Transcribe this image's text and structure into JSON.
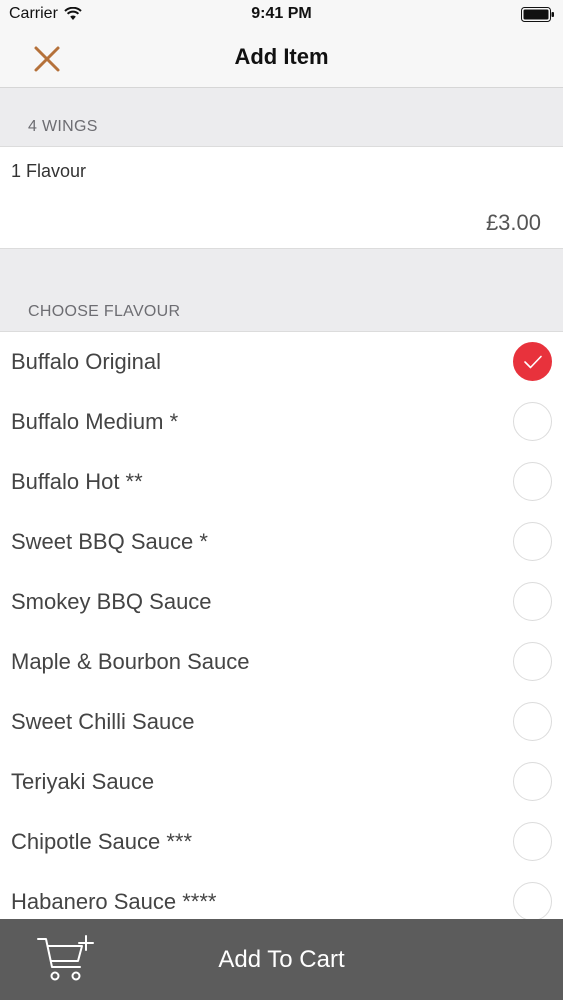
{
  "status_bar": {
    "carrier": "Carrier",
    "time": "9:41 PM",
    "icons": [
      "wifi-icon",
      "battery-icon"
    ]
  },
  "nav": {
    "title": "Add Item",
    "close_icon": "close-icon",
    "accent_color": "#b5713a"
  },
  "item": {
    "section_title": "4 WINGS",
    "description": "1 Flavour",
    "price": "£3.00"
  },
  "flavours": {
    "section_title": "CHOOSE FLAVOUR",
    "selected_color": "#e8323c",
    "options": [
      {
        "label": "Buffalo Original",
        "selected": true
      },
      {
        "label": "Buffalo Medium *",
        "selected": false
      },
      {
        "label": "Buffalo Hot **",
        "selected": false
      },
      {
        "label": "Sweet BBQ Sauce *",
        "selected": false
      },
      {
        "label": "Smokey BBQ Sauce",
        "selected": false
      },
      {
        "label": "Maple & Bourbon Sauce",
        "selected": false
      },
      {
        "label": "Sweet Chilli Sauce",
        "selected": false
      },
      {
        "label": "Teriyaki Sauce",
        "selected": false
      },
      {
        "label": "Chipotle Sauce ***",
        "selected": false
      },
      {
        "label": "Habanero Sauce ****",
        "selected": false
      }
    ]
  },
  "cart": {
    "label": "Add To Cart",
    "icon": "add-to-cart-icon"
  }
}
